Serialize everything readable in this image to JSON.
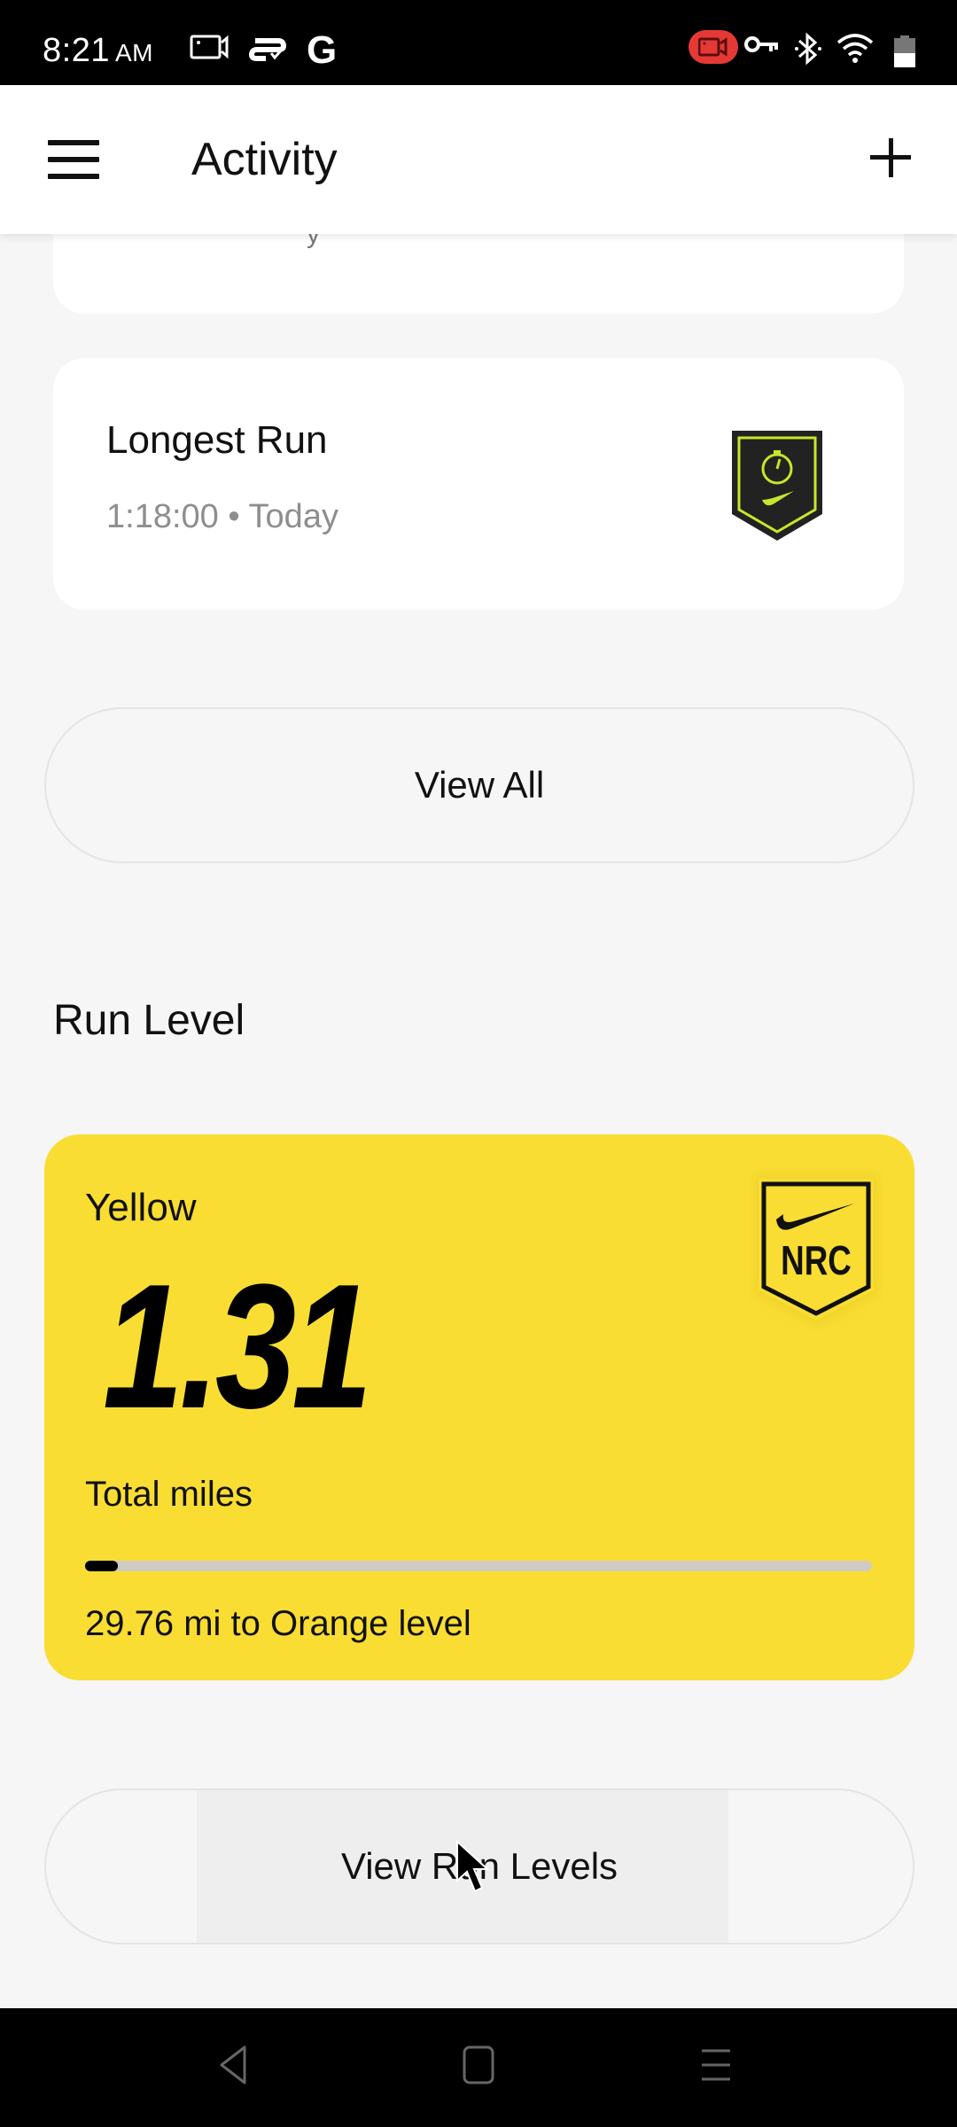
{
  "status_bar": {
    "time": "8:21",
    "ampm": "AM",
    "left_icons": [
      "screen-record-icon",
      "sync-icon",
      "google-icon"
    ],
    "google_glyph": "G",
    "right_icons": [
      "recording-indicator-icon",
      "vpn-key-icon",
      "bluetooth-icon",
      "wifi-icon",
      "battery-icon"
    ]
  },
  "app_bar": {
    "title": "Activity",
    "menu_icon": "hamburger-menu-icon",
    "add_icon": "plus-icon"
  },
  "achievements": [
    {
      "title": "Longest Run",
      "value": "1:18:00",
      "separator": "•",
      "date": "Today",
      "badge_icon": "stopwatch-badge-icon"
    }
  ],
  "partial_card_glyph": "y",
  "view_all_label": "View All",
  "run_level": {
    "section_title": "Run Level",
    "level_name": "Yellow",
    "total_miles": "1.31",
    "total_miles_label": "Total miles",
    "progress_percent": 4.2,
    "remaining_text": "29.76 mi to Orange level",
    "badge_text": "NRC",
    "card_color": "#f9dd33",
    "badge_icon": "nrc-badge-icon"
  },
  "view_run_levels_label": "View Run Levels",
  "colors": {
    "accent_green": "#c8e62a",
    "badge_dark": "#222222",
    "recording_red": "#e53935"
  },
  "nav_bar": {
    "buttons": [
      "back-icon",
      "home-icon",
      "recents-icon"
    ]
  }
}
